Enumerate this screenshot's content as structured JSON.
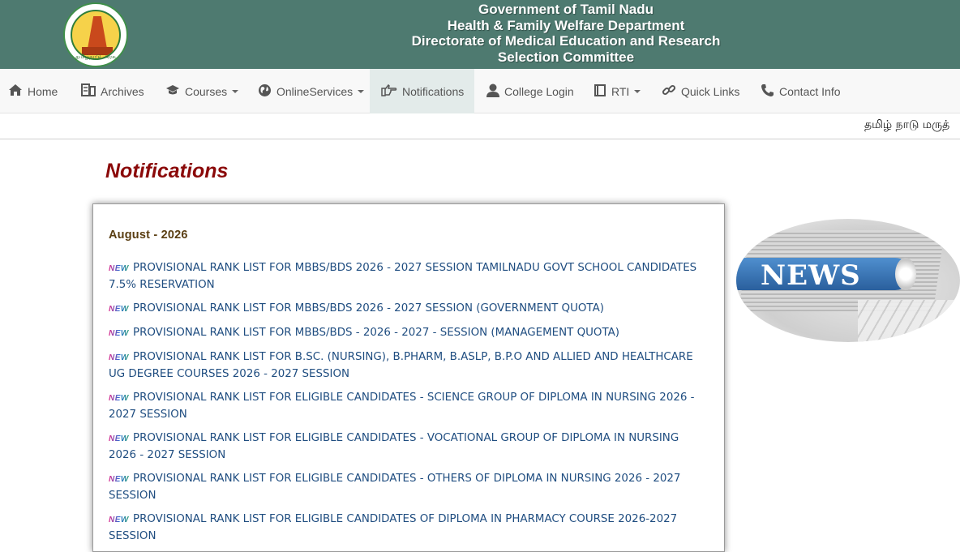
{
  "header": {
    "emblem_label": "தமிழ்நாடு அரசு",
    "titles": [
      "Government of Tamil Nadu",
      "Health & Family Welfare Department",
      "Directorate of Medical Education and Research",
      "Selection Committee"
    ],
    "bg_color": "#4e7a70"
  },
  "nav": {
    "items": [
      {
        "label": "Home",
        "icon": "home-icon"
      },
      {
        "label": "Archives",
        "icon": "archive-icon"
      },
      {
        "label": "Courses",
        "icon": "graduation-cap-icon",
        "dropdown": true
      },
      {
        "label": "OnlineServices",
        "icon": "globe-icon",
        "dropdown": true
      },
      {
        "label": "Notifications",
        "icon": "hand-point-icon",
        "active": true
      },
      {
        "label": "College Login",
        "icon": "user-icon"
      },
      {
        "label": "RTI",
        "icon": "book-icon",
        "dropdown": true
      },
      {
        "label": "Quick Links",
        "icon": "link-icon"
      },
      {
        "label": "Contact Info",
        "icon": "phone-icon"
      }
    ]
  },
  "marquee": {
    "text": "தமிழ் நாடு மருத்"
  },
  "page": {
    "title": "Notifications",
    "month": "August - 2026",
    "new_badge": "NEW",
    "notices": [
      "PROVISIONAL RANK LIST FOR MBBS/BDS 2026 - 2027 SESSION TAMILNADU GOVT SCHOOL CANDIDATES 7.5% RESERVATION",
      "PROVISIONAL RANK LIST FOR MBBS/BDS 2026 - 2027 SESSION (GOVERNMENT QUOTA)",
      "PROVISIONAL RANK LIST FOR MBBS/BDS - 2026 - 2027 - SESSION (MANAGEMENT QUOTA)",
      "PROVISIONAL RANK LIST FOR B.SC. (NURSING), B.PHARM, B.ASLP, B.P.O AND ALLIED AND HEALTHCARE UG DEGREE COURSES 2026 - 2027 SESSION",
      "PROVISIONAL RANK LIST FOR ELIGIBLE CANDIDATES - SCIENCE GROUP OF DIPLOMA IN NURSING 2026 - 2027 SESSION",
      "PROVISIONAL RANK LIST FOR ELIGIBLE CANDIDATES - VOCATIONAL GROUP OF DIPLOMA IN NURSING 2026 - 2027 SESSION",
      "PROVISIONAL RANK LIST FOR ELIGIBLE CANDIDATES - OTHERS OF DIPLOMA IN NURSING 2026 - 2027 SESSION",
      "PROVISIONAL RANK LIST FOR ELIGIBLE CANDIDATES OF DIPLOMA IN PHARMACY COURSE 2026-2027 SESSION"
    ],
    "news_image_text": "NEWS",
    "title_color": "#8b0a0a",
    "link_color": "#1f4d80"
  }
}
